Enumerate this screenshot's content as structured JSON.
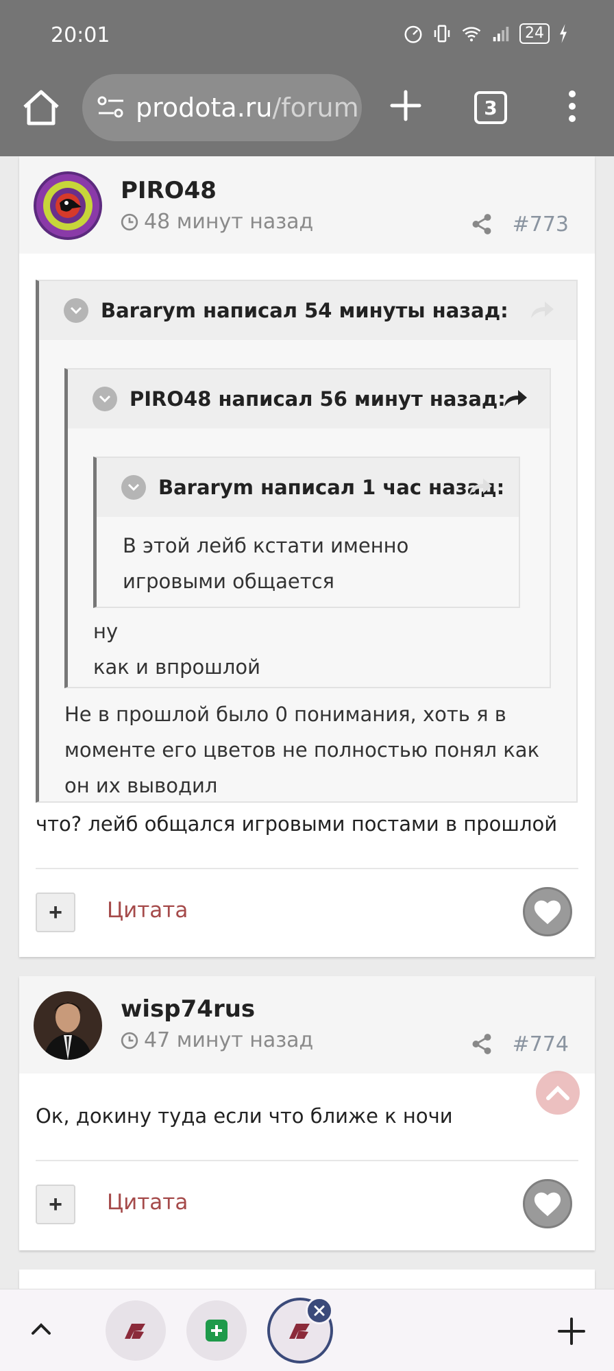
{
  "status_bar": {
    "time": "20:01",
    "battery": "24"
  },
  "browser": {
    "url_host": "prodota.ru",
    "url_path": "/forum",
    "tab_count": "3"
  },
  "posts": [
    {
      "author": "PIRO48",
      "time": "48 минут назад",
      "number": "#773",
      "quote1": {
        "title": "Bararym написал 54 минуты назад:",
        "quote2": {
          "title": "PIRO48 написал 56 минут назад:",
          "quote3": {
            "title": "Bararym написал 1 час назад:",
            "lines": [
              "В этой лейб кстати именно",
              "игровыми общается"
            ]
          },
          "lines": [
            "ну",
            "как и впрошлой"
          ]
        },
        "lines": [
          "Не в прошлой было 0 понимания, хоть я в",
          "моменте его цветов не полностью понял как",
          "он их выводил"
        ]
      },
      "body": "что? лейб общался игровыми постами в прошлой",
      "plus_label": "+",
      "quote_label": "Цитата"
    },
    {
      "author": "wisp74rus",
      "time": "47 минут назад",
      "number": "#774",
      "body": "Ок, докину туда если что ближе к ночи",
      "plus_label": "+",
      "quote_label": "Цитата"
    }
  ],
  "colors": {
    "chrome": "#757575",
    "quote_link": "#a54a4a",
    "accent": "#3b4a7a"
  }
}
